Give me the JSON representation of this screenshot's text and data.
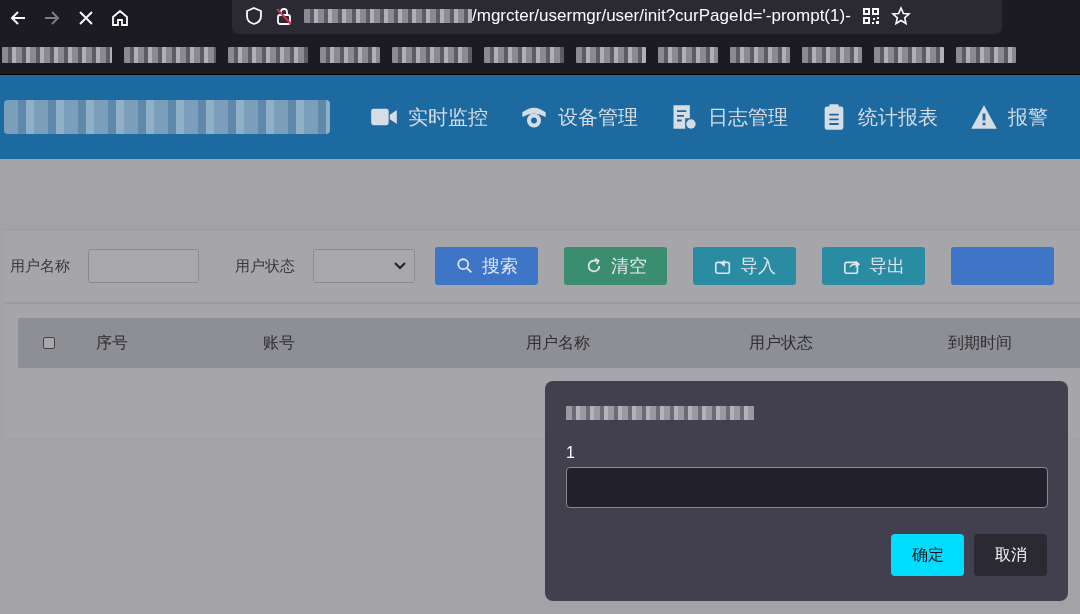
{
  "browser": {
    "url": "/mgrcter/usermgr/user/init?curPageId='-prompt(1)-"
  },
  "nav": [
    {
      "label": "实时监控"
    },
    {
      "label": "设备管理"
    },
    {
      "label": "日志管理"
    },
    {
      "label": "统计报表"
    },
    {
      "label": "报警"
    }
  ],
  "filters": [
    {
      "label": "用户名称",
      "kind": "text"
    },
    {
      "label": "用户状态",
      "kind": "select"
    }
  ],
  "actions": [
    {
      "label": "搜索",
      "color": "#3e75c6"
    },
    {
      "label": "清空",
      "color": "#3b8d70"
    },
    {
      "label": "导入",
      "color": "#2a8ca2"
    },
    {
      "label": "导出",
      "color": "#2a8ca2"
    },
    {
      "color": "#3e75c6"
    }
  ],
  "table": {
    "select_all": {
      "checked": false
    },
    "columns": [
      "序号",
      "账号",
      "用户名称",
      "用户状态",
      "到期时间"
    ]
  },
  "dialog": {
    "message": "1",
    "buttons": [
      {
        "label": "确定",
        "kind": "primary"
      },
      {
        "label": "取消",
        "kind": "secondary"
      }
    ]
  }
}
